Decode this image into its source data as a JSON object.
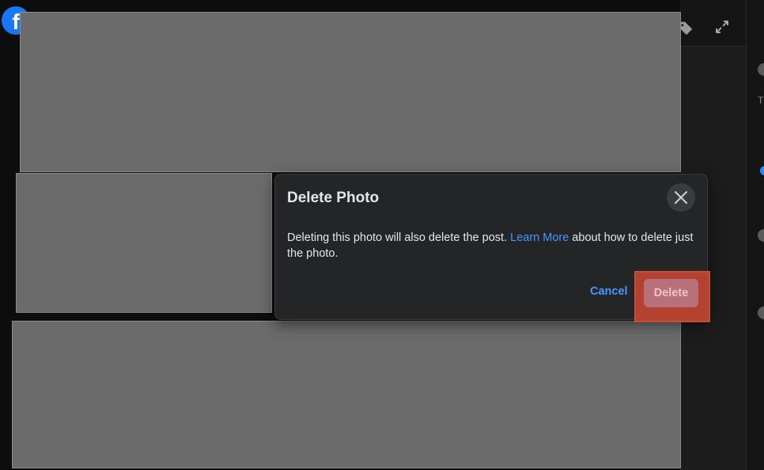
{
  "dialog": {
    "title": "Delete Photo",
    "body_before_link": "Deleting this photo will also delete the post. ",
    "link_text": "Learn More",
    "body_after_link": " about how to delete just the photo.",
    "cancel_label": "Cancel",
    "delete_label": "Delete"
  },
  "header": {
    "logo_letter": "f"
  },
  "side_panel": {
    "partial_text": "T"
  },
  "colors": {
    "accent": "#4599ff",
    "dialog_bg": "#242526",
    "delete_button": "#b8707a",
    "highlight": "#b34230",
    "placeholder": "#6b6b6b"
  },
  "icons": [
    "facebook-logo-icon",
    "tag-icon",
    "expand-icon",
    "close-icon"
  ]
}
